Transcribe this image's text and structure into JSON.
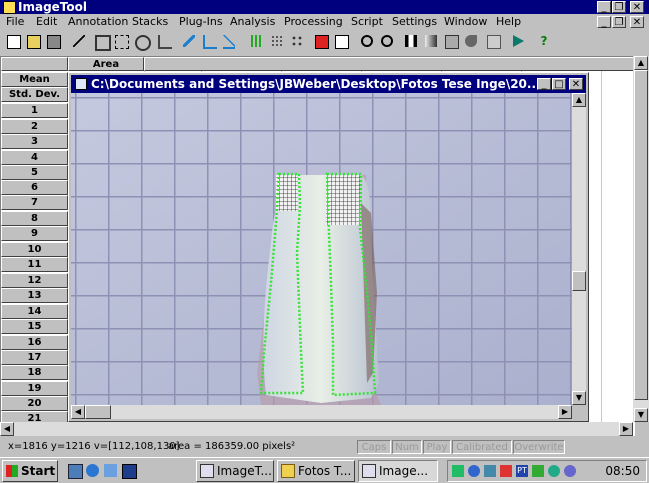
{
  "app": {
    "title": "ImageTool"
  },
  "menu": [
    "File",
    "Edit",
    "Annotation",
    "Stacks",
    "Plug-Ins",
    "Analysis",
    "Processing",
    "Script",
    "Settings",
    "Window",
    "Help"
  ],
  "toolbar_icons": [
    "new-icon",
    "open-icon",
    "print-icon",
    "line-tool-icon",
    "crop-icon",
    "zoom-fit-icon",
    "rotate-icon",
    "undo-icon",
    "measure-icon",
    "angle-icon",
    "scale-icon",
    "histogram-icon",
    "dots-icon",
    "pixel-icon",
    "profile-icon",
    "graph-icon",
    "zoom-in-icon",
    "zoom-out-icon",
    "calibrate-icon",
    "threshold-icon",
    "filter-icon",
    "stack-icon",
    "3d-icon",
    "play-icon",
    "help-icon"
  ],
  "sheet": {
    "column_header": "Area",
    "row_labels": [
      "Mean",
      "Std. Dev.",
      "1",
      "2",
      "3",
      "4",
      "5",
      "6",
      "7",
      "8",
      "9",
      "10",
      "11",
      "12",
      "13",
      "14",
      "15",
      "16",
      "17",
      "18",
      "19",
      "20",
      "21"
    ]
  },
  "image_window": {
    "title": "C:\\Documents and Settings\\JBWeber\\Desktop\\Fotos Tese Inge\\20..."
  },
  "status": {
    "coords": "x=1816 y=1216 v=[112,108,130]",
    "area": "area = 186359.00 pixels²",
    "indicators": [
      "Caps",
      "Num",
      "Play",
      "Calibrated",
      "Overwrite"
    ]
  },
  "taskbar": {
    "start": "Start",
    "tasks": [
      "ImageT...",
      "Fotos T...",
      "Image..."
    ],
    "clock": "08:50"
  }
}
